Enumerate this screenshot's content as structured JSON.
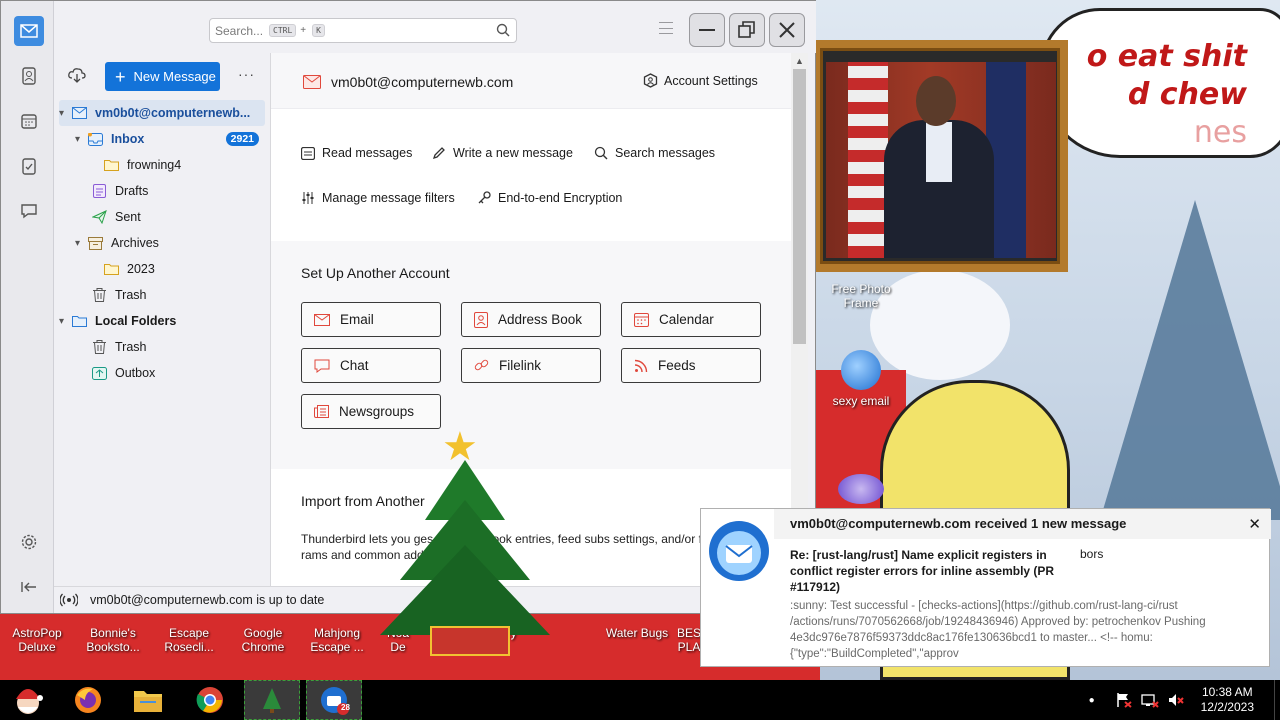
{
  "desktop": {
    "bubble_lines": [
      "o eat shit",
      "d chew",
      "nes"
    ],
    "icons": [
      {
        "label": "Free Photo Frame"
      },
      {
        "label": "sexy email"
      }
    ],
    "bottom_icons": [
      "AstroPop Deluxe",
      "Bonnie's Booksto...",
      "Escape Rosecli...",
      "Google Chrome",
      "Mahjong Escape ...",
      "Noa De",
      "renzy",
      "Water Bugs",
      "BES PLA"
    ]
  },
  "window": {
    "search_placeholder": "Search...",
    "search_kbd1": "CTRL",
    "search_plus": "+",
    "search_kbd2": "K"
  },
  "folder_pane": {
    "new_message_label": "New Message",
    "more_label": "···",
    "folders": [
      {
        "name": "vm0b0t@computernewb...",
        "badge": ""
      },
      {
        "name": "Inbox",
        "badge": "2921"
      },
      {
        "name": "frowning4",
        "badge": ""
      },
      {
        "name": "Drafts",
        "badge": ""
      },
      {
        "name": "Sent",
        "badge": ""
      },
      {
        "name": "Archives",
        "badge": ""
      },
      {
        "name": "2023",
        "badge": ""
      },
      {
        "name": "Trash",
        "badge": ""
      },
      {
        "name": "Local Folders",
        "badge": ""
      },
      {
        "name": "Trash",
        "badge": ""
      },
      {
        "name": "Outbox",
        "badge": ""
      }
    ]
  },
  "content": {
    "account_name": "vm0b0t@computernewb.com",
    "account_settings": "Account Settings",
    "actions": {
      "read": "Read messages",
      "write": "Write a new message",
      "search": "Search messages",
      "filters": "Manage message filters",
      "e2e": "End-to-end Encryption"
    },
    "setup_title": "Set Up Another Account",
    "setup_buttons": [
      "Email",
      "Address Book",
      "Calendar",
      "Chat",
      "Filelink",
      "Feeds",
      "Newsgroups"
    ],
    "import_title": "Import from Another",
    "import_text": "Thunderbird lets you                      ges, address book entries, feed subs settings, and/or filt                          rams and common address book"
  },
  "status_text": "vm0b0t@computernewb.com is up to date",
  "notification": {
    "title": "vm0b0t@computernewb.com received 1 new message",
    "subject": "Re: [rust-lang/rust] Name explicit registers in conflict register errors for inline assembly (PR #117912)",
    "sender": "bors",
    "preview": ":sunny: Test successful - [checks-actions](https://github.com/rust-lang-ci/rust /actions/runs/7070562668/job/19248436946) Approved by: petrochenkov Pushing 4e3dc976e7876f59373ddc8ac176fe130636bcd1 to master... <!-- homu: {\"type\":\"BuildCompleted\",\"approv",
    "close": "✕"
  },
  "taskbar": {
    "time": "10:38 AM",
    "date": "12/2/2023",
    "thunderbird_badge": "28"
  },
  "colors": {
    "accent": "#1373d9",
    "badge": "#1373d9"
  }
}
